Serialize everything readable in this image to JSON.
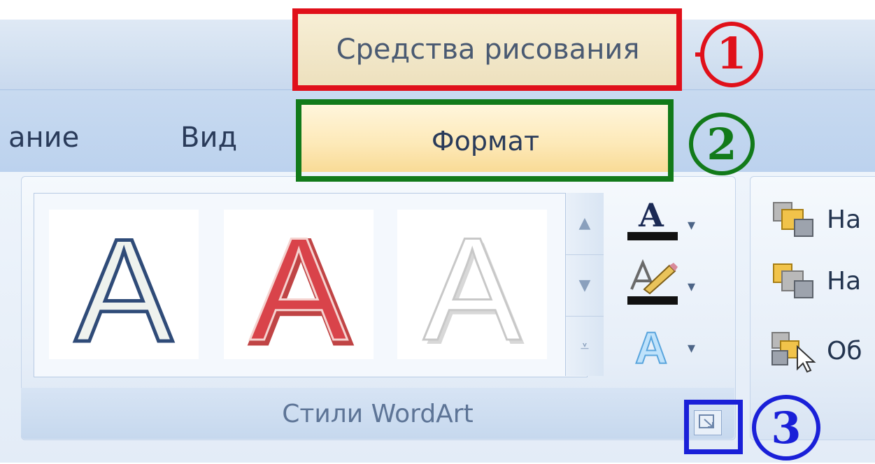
{
  "title_bar": {
    "context_tab_label": "Средства рисования"
  },
  "tabs": {
    "partial_tab": "ание",
    "view": "Вид",
    "format": "Формат"
  },
  "wordart_gallery": {
    "styles": [
      {
        "letter": "A",
        "style": "blue-outline"
      },
      {
        "letter": "A",
        "style": "red-outline"
      },
      {
        "letter": "A",
        "style": "white-shadow"
      }
    ]
  },
  "tools": {
    "text_fill_icon": "text-fill-icon",
    "text_outline_icon": "text-outline-icon",
    "text_effects_icon": "text-effects-icon",
    "text_fill_letter": "A"
  },
  "group_label": "Стили WordArt",
  "arrange_group": {
    "items": [
      {
        "icon": "bring-forward-icon",
        "label": "На"
      },
      {
        "icon": "send-backward-icon",
        "label": "На"
      },
      {
        "icon": "selection-pane-icon",
        "label": "Об"
      }
    ]
  },
  "annotations": {
    "one": "1",
    "two": "2",
    "three": "3",
    "colors": {
      "one": "#e0101a",
      "two": "#127a1a",
      "three": "#1a20d8"
    }
  }
}
